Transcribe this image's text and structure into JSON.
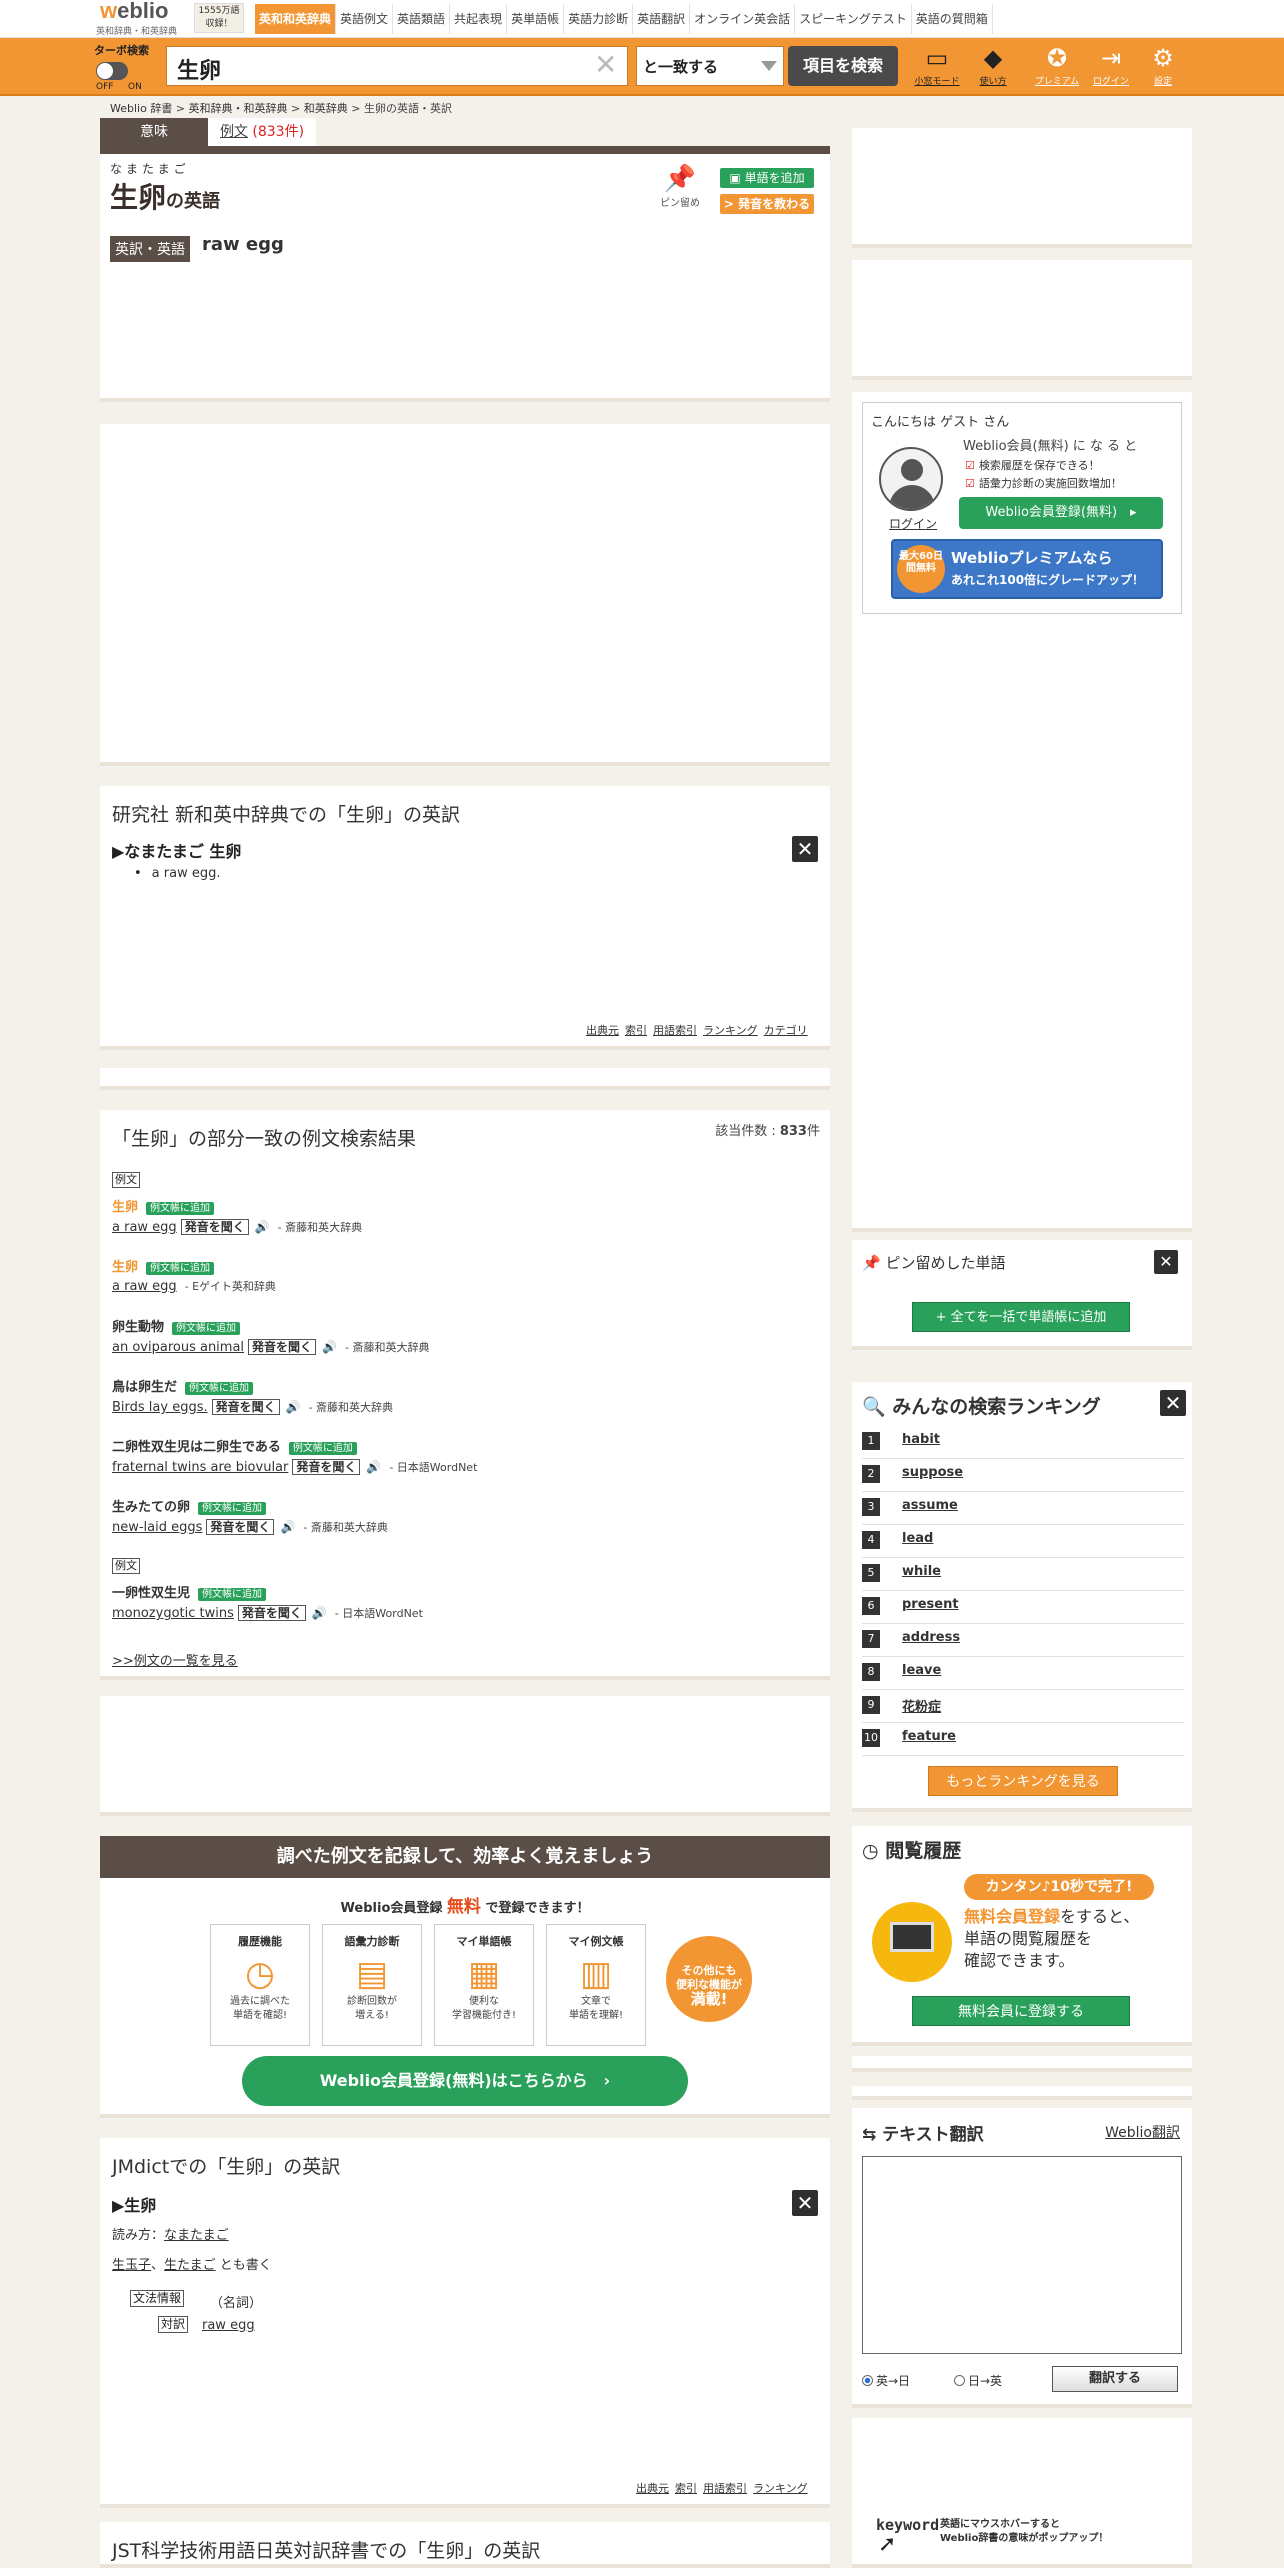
{
  "nav": {
    "logo": "weblio",
    "logo_sub": "英和辞典・和英辞典",
    "badge_line1": "1555万語",
    "badge_line2": "収録！",
    "tabs": [
      "英和和英辞典",
      "英語例文",
      "英語類語",
      "共起表現",
      "英単語帳",
      "英語力診断",
      "英語翻訳",
      "オンライン英会話",
      "スピーキングテスト",
      "英語の質問箱"
    ]
  },
  "search": {
    "turbo_label": "ターボ検索",
    "off": "OFF",
    "on": "ON",
    "query": "生卵",
    "clear": "✕",
    "match": "と一致する",
    "button": "項目を検索",
    "icons": [
      {
        "name": "small-screen-mode-icon",
        "glyph": "▭",
        "label": "小窓モード"
      },
      {
        "name": "howto-icon",
        "glyph": "◆",
        "label": "使い方"
      },
      {
        "name": "premium-icon",
        "glyph": "✪",
        "label": "プレミアム"
      },
      {
        "name": "login-icon",
        "glyph": "⇥",
        "label": "ログイン"
      },
      {
        "name": "settings-icon",
        "glyph": "⚙",
        "label": "設定"
      }
    ]
  },
  "breadcrumb": {
    "items": [
      "Weblio 辞書",
      "英和辞典・和英辞典",
      "和英辞典",
      "生卵の英語・英訳"
    ],
    "sep": " > "
  },
  "tabs": {
    "meaning": "意味",
    "examples_prefix": "例文",
    "examples_count": "(833件)"
  },
  "headword": {
    "ruby": "なまたまご",
    "word": "生卵",
    "suffix": "の英語",
    "pin_label": "ピン留め",
    "add_word": "単語を追加",
    "teach_pron": "発音を教わる",
    "trans_label": "英訳・英語",
    "trans_value": "raw egg"
  },
  "shinei": {
    "title": "研究社 新和英中辞典での「生卵」の英訳",
    "entry": "▶なまたまご 生卵",
    "close": "✕",
    "items": [
      "a raw egg."
    ],
    "footer": [
      "出典元",
      "索引",
      "用語索引",
      "ランキング",
      "カテゴリ"
    ]
  },
  "examples": {
    "title": "「生卵」の部分一致の例文検索結果",
    "count_label": "該当件数 :",
    "count_value": "833",
    "count_unit": "件",
    "box_label": "例文",
    "add_label": "例文帳に追加",
    "pron_label": "発音を聞く",
    "speaker": "🔊",
    "list": [
      {
        "jp": [
          "生卵"
        ],
        "en": "a raw egg",
        "src": "- 斎藤和英大辞典"
      },
      {
        "jp": [
          "生卵"
        ],
        "en": "a raw egg",
        "src": "- Eゲイト英和辞典"
      },
      {
        "jp": [
          "卵生動物"
        ],
        "en": "an oviparous animal",
        "src": "- 斎藤和英大辞典"
      },
      {
        "jp": [
          "鳥は卵生だ"
        ],
        "en": "Birds lay eggs.",
        "src": "- 斎藤和英大辞典"
      },
      {
        "jp": [
          "二卵性双生児は二卵生である"
        ],
        "en": "fraternal twins are biovular",
        "src": "- 日本語WordNet"
      },
      {
        "jp": [
          "生みたての卵"
        ],
        "en": "new-laid eggs",
        "src": "- 斎藤和英大辞典"
      },
      {
        "jp": [
          "一卵性双生児"
        ],
        "en": "monozygotic twins",
        "src": "- 日本語WordNet"
      }
    ],
    "more": ">>例文の一覧を見る"
  },
  "promo": {
    "bar": "調べた例文を記録して、効率よく覚えましょう",
    "line_prefix": "Weblio会員登録",
    "line_free": "無料",
    "line_suffix": "で登録できます！",
    "features": [
      {
        "title": "履歴機能",
        "icon": "◷",
        "l1": "過去に調べた",
        "l2": "単語を確認!"
      },
      {
        "title": "語彙力診断",
        "icon": "▤",
        "l1": "診断回数が",
        "l2": "増える!"
      },
      {
        "title": "マイ単語帳",
        "icon": "▦",
        "l1": "便利な",
        "l2": "学習機能付き!"
      },
      {
        "title": "マイ例文帳",
        "icon": "▥",
        "l1": "文章で",
        "l2": "単語を理解!"
      }
    ],
    "circle_l1": "その他にも",
    "circle_l2": "便利な機能が",
    "circle_l3": "満載!",
    "button": "Weblio会員登録(無料)はこちらから　›"
  },
  "jmdict": {
    "title": "JMdictでの「生卵」の英訳",
    "entry": "▶生卵",
    "reading_label": "読み方：",
    "reading": "なまたまご",
    "alt1": "生玉子",
    "alt2": "生たまご",
    "alt_suffix": "とも書く",
    "grammar_label": "文法情報",
    "grammar_value": "（名詞）",
    "trans_label": "対訳",
    "trans_value": "raw egg",
    "footer": [
      "出典元",
      "索引",
      "用語索引",
      "ランキング"
    ]
  },
  "jst": {
    "title": "JST科学技術用語日英対訳辞書での「生卵」の英訳"
  },
  "guest": {
    "hello": "こんにちは ゲスト さん",
    "member": "Weblio会員(無料) に な る と",
    "check1": "検索履歴を保存できる！",
    "check2": "語彙力診断の実施回数増加！",
    "login": "ログイン",
    "register": "Weblio会員登録(無料)　▸",
    "premium_sticker": "最大60日間無料",
    "premium_l1": "Weblioプレミアムなら",
    "premium_l2": "あれこれ100倍にグレードアップ！"
  },
  "pinned": {
    "title": "ピン留めした単語",
    "close": "✕",
    "add_all": "+ 全てを一括で単語帳に追加"
  },
  "ranking": {
    "title": "みんなの検索ランキング",
    "close": "✕",
    "items": [
      "habit",
      "suppose",
      "assume",
      "lead",
      "while",
      "present",
      "address",
      "leave",
      "花粉症",
      "feature"
    ],
    "more": "もっとランキングを見る"
  },
  "history": {
    "title": "閲覧履歴",
    "pill": "カンタン♪10秒で完了!",
    "line1_o": "無料会員登録",
    "line1": "をすると、",
    "line2": "単語の閲覧履歴を",
    "line3": "確認できます。",
    "button": "無料会員に登録する"
  },
  "translate": {
    "title": "テキスト翻訳",
    "link": "Weblio翻訳",
    "radio1": "英→日",
    "radio2": "日→英",
    "button": "翻訳する"
  },
  "keyword": {
    "word": "keyword",
    "line1": "英語にマウスホバーすると",
    "line2": "Weblio辞書の意味がポップアップ！"
  },
  "colors": {
    "brand": "#f29633",
    "dark": "#5a4e47",
    "green": "#2aa15a"
  }
}
